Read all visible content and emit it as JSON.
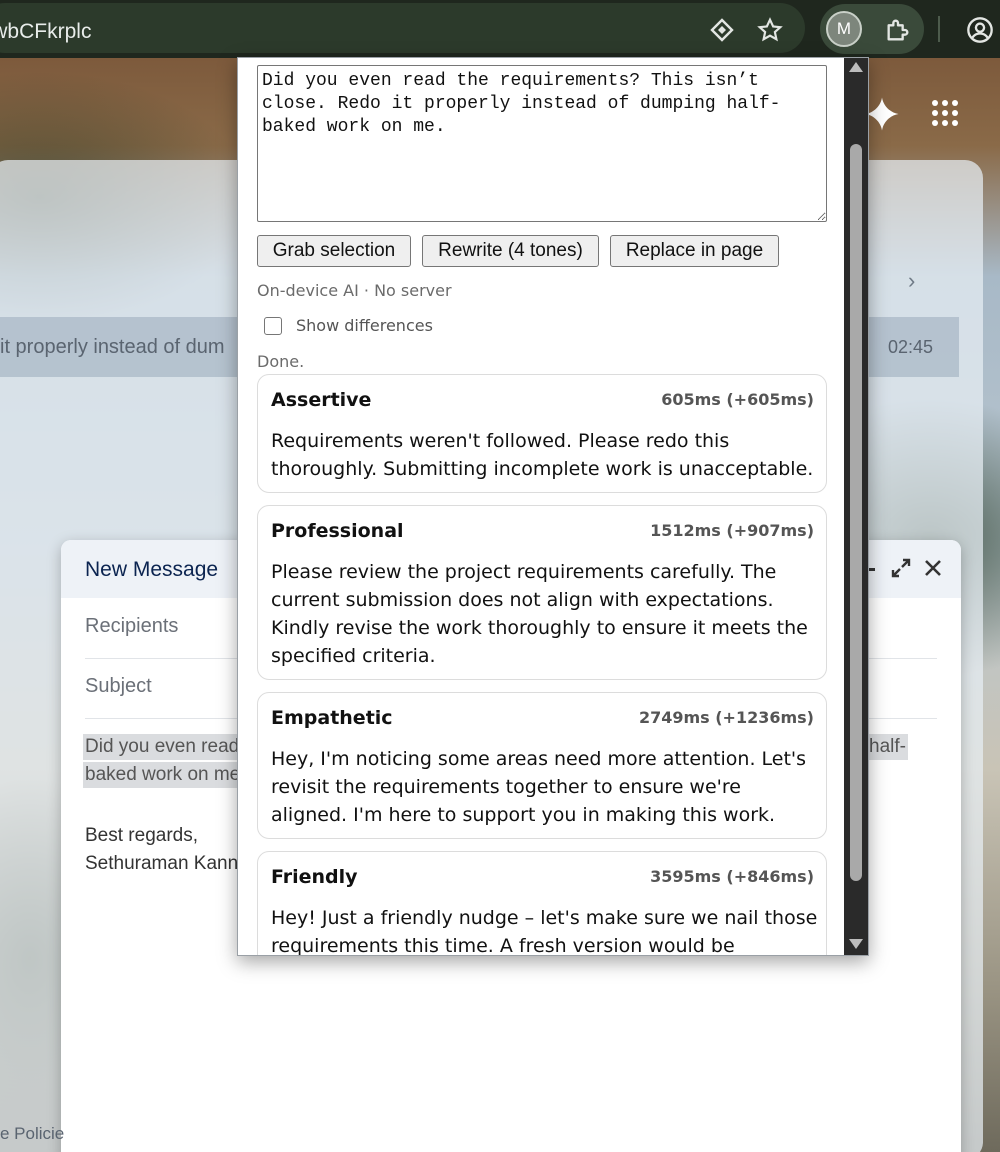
{
  "browser": {
    "url_fragment": "=wbCFkrplc",
    "profile_initial": "M",
    "icons": [
      "lens-icon",
      "star-icon",
      "puzzle-icon",
      "profile-icon"
    ]
  },
  "gmail": {
    "email_snippet": "it properly instead of dum",
    "email_time": "02:45",
    "compose": {
      "title": "New Message",
      "recipients_placeholder": "Recipients",
      "subject_placeholder": "Subject",
      "body_line1": "Did you even read",
      "body_line1_end": "half-",
      "body_line2": "baked work on me",
      "signature_line1": "Best regards,",
      "signature_line2": "Sethuraman Kann"
    },
    "footer_text": "e Policie"
  },
  "popup": {
    "input_text": "Did you even read the requirements? This isn’t close. Redo it properly instead of dumping half-baked work on me.",
    "buttons": {
      "grab": "Grab selection",
      "rewrite": "Rewrite (4 tones)",
      "replace": "Replace in page"
    },
    "meta_note": "On-device AI · No server",
    "show_differences_label": "Show differences",
    "show_differences_checked": false,
    "status": "Done.",
    "results": [
      {
        "tone": "Assertive",
        "timing": "605ms (+605ms)",
        "text": "Requirements weren't followed. Please redo this thoroughly. Submitting incomplete work is unacceptable."
      },
      {
        "tone": "Professional",
        "timing": "1512ms (+907ms)",
        "text": "Please review the project requirements carefully. The current submission does not align with expectations. Kindly revise the work thoroughly to ensure it meets the specified criteria."
      },
      {
        "tone": "Empathetic",
        "timing": "2749ms (+1236ms)",
        "text": "Hey, I'm noticing some areas need more attention. Let's revisit the requirements together to ensure we're aligned. I'm here to support you in making this work."
      },
      {
        "tone": "Friendly",
        "timing": "3595ms (+846ms)",
        "text": "Hey! Just a friendly nudge – let's make sure we nail those requirements this time. A fresh version would be"
      }
    ]
  }
}
